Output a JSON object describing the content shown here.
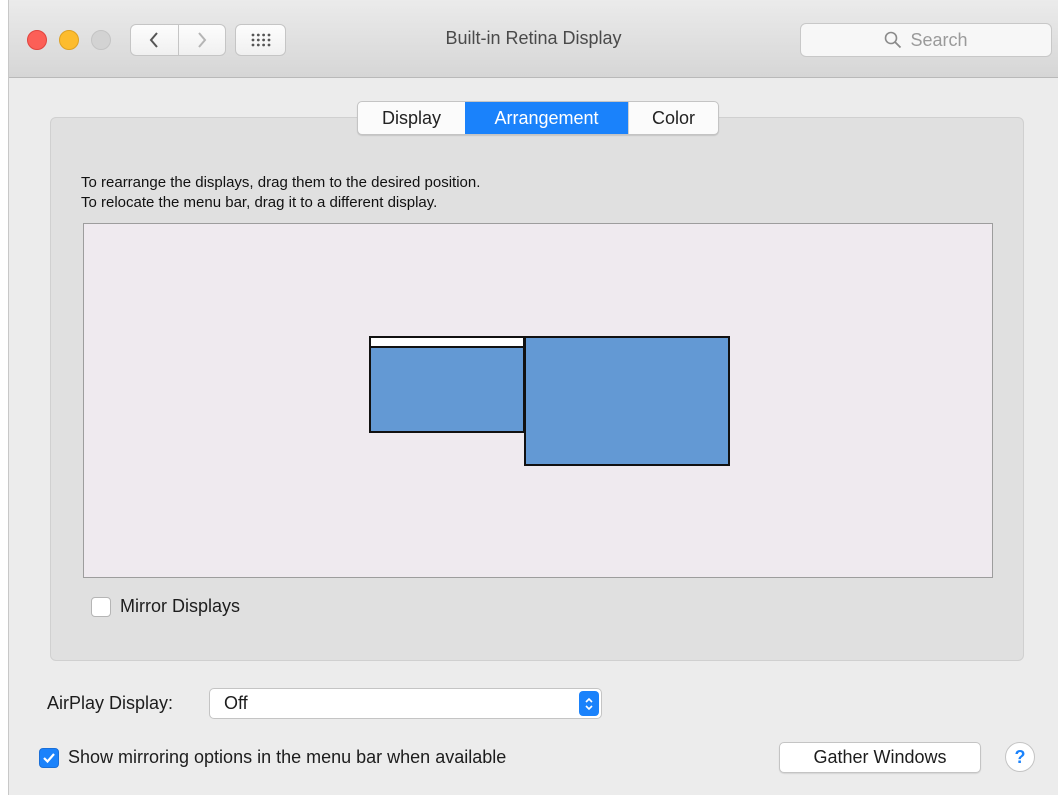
{
  "window": {
    "title": "Built-in Retina Display"
  },
  "toolbar": {
    "search_placeholder": "Search"
  },
  "tabs": [
    {
      "label": "Display",
      "selected": false
    },
    {
      "label": "Arrangement",
      "selected": true
    },
    {
      "label": "Color",
      "selected": false
    }
  ],
  "arrangement": {
    "instruction_line1": "To rearrange the displays, drag them to the desired position.",
    "instruction_line2": "To relocate the menu bar, drag it to a different display.",
    "mirror_label": "Mirror Displays",
    "mirror_checked": false
  },
  "airplay": {
    "label": "AirPlay Display:",
    "value": "Off"
  },
  "footer": {
    "show_mirroring_label": "Show mirroring options in the menu bar when available",
    "show_mirroring_checked": true,
    "gather_button": "Gather Windows",
    "help_button": "?"
  },
  "colors": {
    "accent": "#1a82fb",
    "display_fill": "#6399d4",
    "arrangement_bg": "#efeaef"
  }
}
